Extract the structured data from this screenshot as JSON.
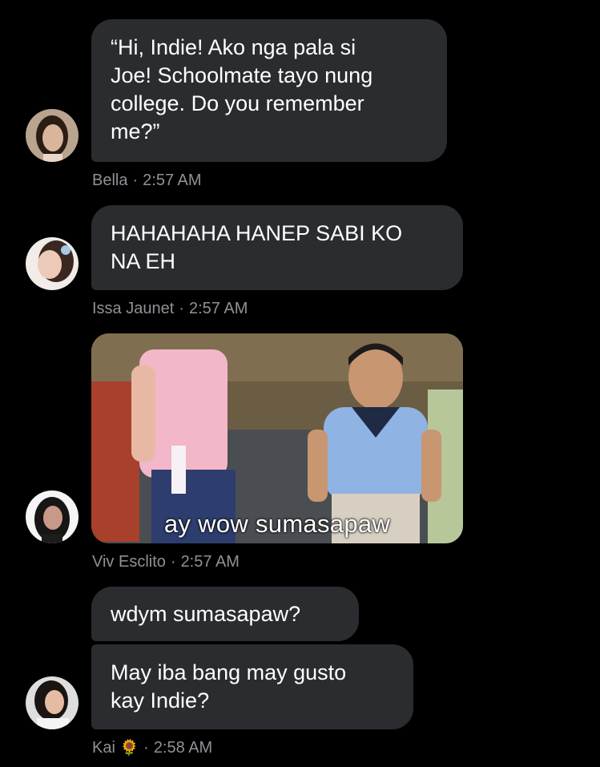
{
  "messages": [
    {
      "sender": "Bella",
      "time": "2:57 AM",
      "text": "“Hi, Indie! Ako nga pala si\nJoe! Schoolmate tayo nung\ncollege. Do you remember\nme?”"
    },
    {
      "sender": "Issa Jaunet",
      "time": "2:57 AM",
      "text": "HAHAHAHA HANEP SABI KO\nNA EH"
    },
    {
      "sender": "Viv Esclito",
      "time": "2:57 AM",
      "image_caption": "ay wow sumasapaw"
    },
    {
      "sender": "Kai",
      "sender_emoji": "🌻",
      "time": "2:58 AM",
      "texts": [
        "wdym sumasapaw?",
        "May iba bang may gusto\nkay Indie?"
      ]
    }
  ],
  "separator": "·",
  "colors": {
    "background": "#000000",
    "bubble": "#2a2c2f",
    "meta_text": "#8e9196",
    "message_text": "#ffffff"
  }
}
